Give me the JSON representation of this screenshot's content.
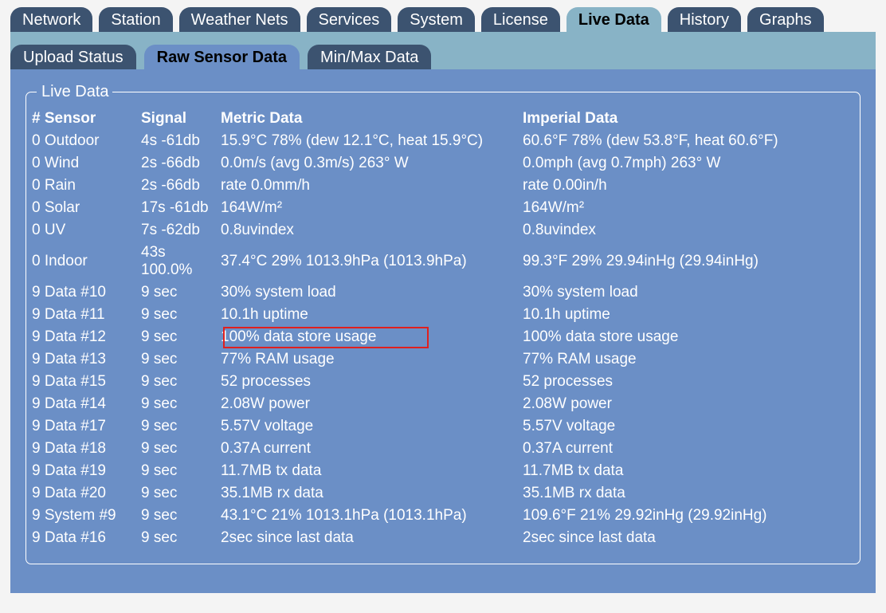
{
  "main_tabs": [
    {
      "label": "Network"
    },
    {
      "label": "Station"
    },
    {
      "label": "Weather Nets"
    },
    {
      "label": "Services"
    },
    {
      "label": "System"
    },
    {
      "label": "License"
    },
    {
      "label": "Live Data",
      "active": true
    },
    {
      "label": "History"
    },
    {
      "label": "Graphs"
    }
  ],
  "sub_tabs": [
    {
      "label": "Upload Status"
    },
    {
      "label": "Raw Sensor Data",
      "active": true
    },
    {
      "label": "Min/Max Data"
    }
  ],
  "panel": {
    "legend": "Live Data"
  },
  "table": {
    "headers": {
      "sensor": "# Sensor",
      "signal": "Signal",
      "metric": "Metric Data",
      "imperial": "Imperial Data"
    },
    "rows": [
      {
        "sensor": "0 Outdoor",
        "signal": "4s -61db",
        "metric": "15.9°C 78% (dew 12.1°C, heat 15.9°C)",
        "imperial": "60.6°F 78% (dew 53.8°F, heat 60.6°F)"
      },
      {
        "sensor": "0 Wind",
        "signal": "2s -66db",
        "metric": "0.0m/s (avg 0.3m/s) 263° W",
        "imperial": "0.0mph (avg 0.7mph) 263° W"
      },
      {
        "sensor": "0 Rain",
        "signal": "2s -66db",
        "metric": "rate 0.0mm/h",
        "imperial": "rate 0.00in/h"
      },
      {
        "sensor": "0 Solar",
        "signal": "17s -61db",
        "metric": "164W/m²",
        "imperial": "164W/m²"
      },
      {
        "sensor": "0 UV",
        "signal": "7s -62db",
        "metric": "0.8uvindex",
        "imperial": "0.8uvindex"
      },
      {
        "sensor": "0 Indoor",
        "signal": "43s",
        "signal_line2": "100.0%",
        "metric": "37.4°C 29% 1013.9hPa (1013.9hPa)",
        "imperial": "99.3°F 29% 29.94inHg (29.94inHg)"
      },
      {
        "sensor": "9 Data #10",
        "signal": "9 sec",
        "metric": "30% system load",
        "imperial": "30% system load"
      },
      {
        "sensor": "9 Data #11",
        "signal": "9 sec",
        "metric": "10.1h uptime",
        "imperial": "10.1h uptime"
      },
      {
        "sensor": "9 Data #12",
        "signal": "9 sec",
        "metric": "100% data store usage",
        "imperial": "100% data store usage"
      },
      {
        "sensor": "9 Data #13",
        "signal": "9 sec",
        "metric": "77% RAM usage",
        "imperial": "77% RAM usage"
      },
      {
        "sensor": "9 Data #15",
        "signal": "9 sec",
        "metric": "52 processes",
        "imperial": "52 processes"
      },
      {
        "sensor": "9 Data #14",
        "signal": "9 sec",
        "metric": "2.08W power",
        "imperial": "2.08W power"
      },
      {
        "sensor": "9 Data #17",
        "signal": "9 sec",
        "metric": "5.57V voltage",
        "imperial": "5.57V voltage"
      },
      {
        "sensor": "9 Data #18",
        "signal": "9 sec",
        "metric": "0.37A current",
        "imperial": "0.37A current"
      },
      {
        "sensor": "9 Data #19",
        "signal": "9 sec",
        "metric": "11.7MB tx data",
        "imperial": "11.7MB tx data"
      },
      {
        "sensor": "9 Data #20",
        "signal": "9 sec",
        "metric": "35.1MB rx data",
        "imperial": "35.1MB rx data"
      },
      {
        "sensor": "9 System #9",
        "signal": "9 sec",
        "metric": "43.1°C 21% 1013.1hPa (1013.1hPa)",
        "imperial": "109.6°F 21% 29.92inHg (29.92inHg)"
      },
      {
        "sensor": "9 Data #16",
        "signal": "9 sec",
        "metric": "2sec since last data",
        "imperial": "2sec since last data"
      }
    ]
  },
  "colors": {
    "tab_dark": "#3c5370",
    "tab_light": "#88b3c6",
    "content_bg": "#6b8fc6",
    "highlight": "#e0201e"
  }
}
